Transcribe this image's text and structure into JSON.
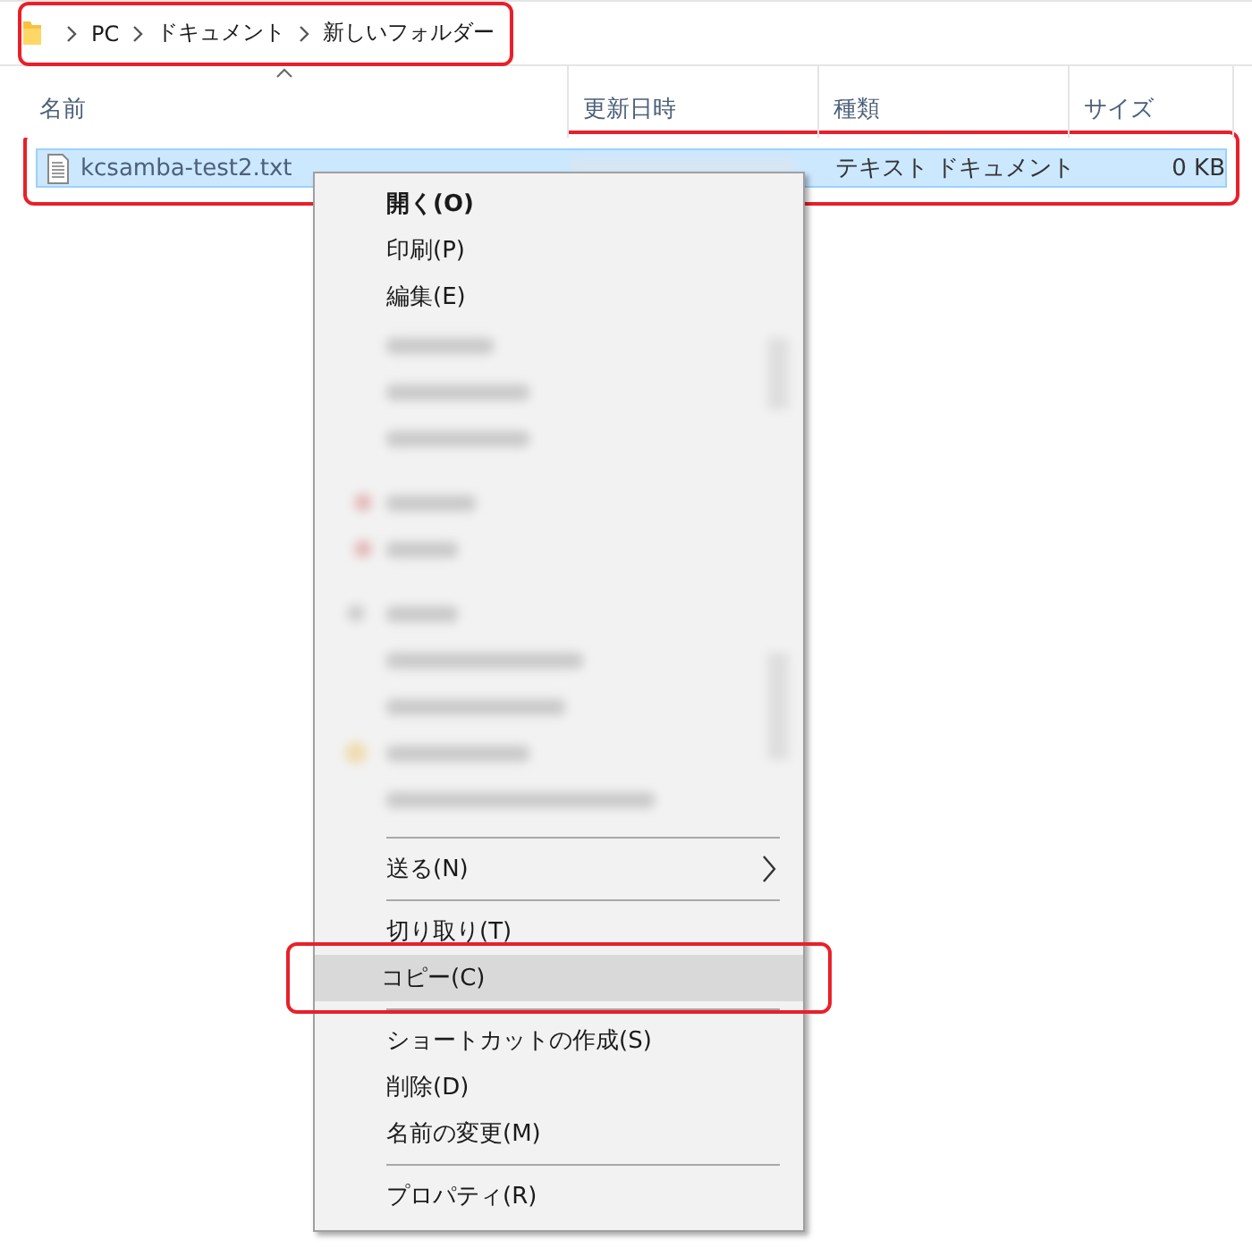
{
  "breadcrumb": {
    "highlighted": true,
    "segments": [
      "PC",
      "ドキュメント",
      "新しいフォルダー"
    ]
  },
  "file_list": {
    "columns": [
      {
        "label": "名前",
        "sorted": true
      },
      {
        "label": "更新日時",
        "sorted": false
      },
      {
        "label": "種類",
        "sorted": false
      },
      {
        "label": "サイズ",
        "sorted": false
      }
    ],
    "rows": [
      {
        "name": "kcsamba-test2.txt",
        "modified_blurred": true,
        "type": "テキスト ドキュメント",
        "size": "0 KB",
        "selected": true,
        "highlighted": true
      }
    ]
  },
  "context_menu": {
    "items": [
      {
        "kind": "item",
        "label": "開く(O)",
        "default": true,
        "submenu": false,
        "selected": false,
        "highlighted": false
      },
      {
        "kind": "item",
        "label": "印刷(P)",
        "default": false,
        "submenu": false,
        "selected": false,
        "highlighted": false
      },
      {
        "kind": "item",
        "label": "編集(E)",
        "default": false,
        "submenu": false,
        "selected": false,
        "highlighted": false
      },
      {
        "kind": "blurred"
      },
      {
        "kind": "separator"
      },
      {
        "kind": "item",
        "label": "送る(N)",
        "default": false,
        "submenu": true,
        "selected": false,
        "highlighted": false
      },
      {
        "kind": "separator"
      },
      {
        "kind": "item",
        "label": "切り取り(T)",
        "default": false,
        "submenu": false,
        "selected": false,
        "highlighted": false
      },
      {
        "kind": "item",
        "label": "コピー(C)",
        "default": false,
        "submenu": false,
        "selected": true,
        "highlighted": true
      },
      {
        "kind": "separator"
      },
      {
        "kind": "item",
        "label": "ショートカットの作成(S)",
        "default": false,
        "submenu": false,
        "selected": false,
        "highlighted": false
      },
      {
        "kind": "item",
        "label": "削除(D)",
        "default": false,
        "submenu": false,
        "selected": false,
        "highlighted": false
      },
      {
        "kind": "item",
        "label": "名前の変更(M)",
        "default": false,
        "submenu": false,
        "selected": false,
        "highlighted": false
      },
      {
        "kind": "separator"
      },
      {
        "kind": "item",
        "label": "プロパティ(R)",
        "default": false,
        "submenu": false,
        "selected": false,
        "highlighted": false
      }
    ]
  }
}
